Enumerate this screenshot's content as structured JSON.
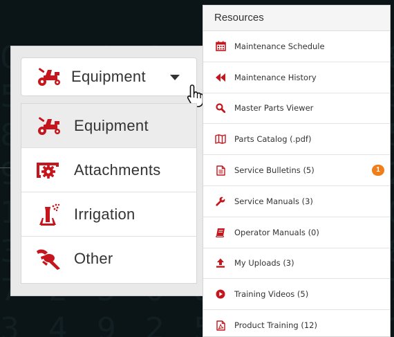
{
  "colors": {
    "brand_red": "#c4161c",
    "badge_orange": "#f07e1a",
    "background": "#0b1518"
  },
  "dropdown": {
    "selected": {
      "label": "Equipment",
      "icon": "mower-icon"
    },
    "items": [
      {
        "label": "Equipment",
        "icon": "mower-icon",
        "active": true
      },
      {
        "label": "Attachments",
        "icon": "attachment-icon",
        "active": false
      },
      {
        "label": "Irrigation",
        "icon": "sprinkler-icon",
        "active": false
      },
      {
        "label": "Other",
        "icon": "blower-icon",
        "active": false
      }
    ]
  },
  "resources": {
    "title": "Resources",
    "items": [
      {
        "label": "Maintenance Schedule",
        "icon": "calendar-icon"
      },
      {
        "label": "Maintenance History",
        "icon": "rewind-icon"
      },
      {
        "label": "Master Parts Viewer",
        "icon": "search-icon"
      },
      {
        "label": "Parts Catalog (.pdf)",
        "icon": "map-icon"
      },
      {
        "label": "Service Bulletins (5)",
        "icon": "document-icon",
        "badge": "1"
      },
      {
        "label": "Service Manuals (3)",
        "icon": "wrench-icon"
      },
      {
        "label": "Operator Manuals (0)",
        "icon": "book-icon"
      },
      {
        "label": "My Uploads (3)",
        "icon": "upload-icon"
      },
      {
        "label": "Training Videos (5)",
        "icon": "play-icon"
      },
      {
        "label": "Product Training (12)",
        "icon": "pdf-icon"
      }
    ]
  }
}
